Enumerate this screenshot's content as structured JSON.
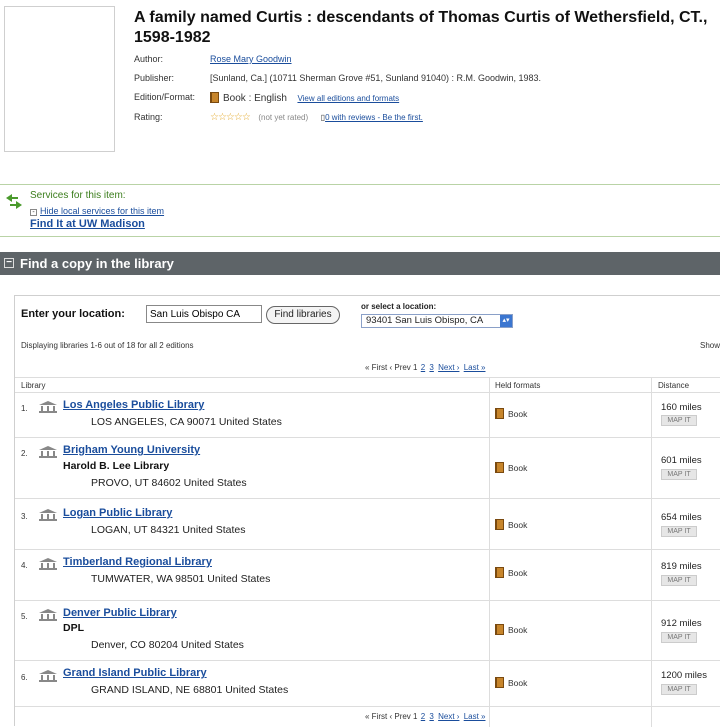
{
  "book": {
    "title": "A family named Curtis : descendants of Thomas Curtis of Wethersfield, CT., 1598-1982",
    "author_label": "Author:",
    "author": "Rose Mary Goodwin",
    "publisher_label": "Publisher:",
    "publisher": "[Sunland, Ca.] (10711 Sherman Grove #51, Sunland 91040) : R.M. Goodwin, 1983.",
    "edition_label": "Edition/Format:",
    "edition": "Book : English",
    "edition_link": "View all editions and formats",
    "rating_label": "Rating:",
    "stars": "☆☆☆☆☆",
    "rating_text": "(not yet rated)",
    "reviews_link": "0 with reviews - Be the first."
  },
  "services": {
    "heading": "Services for this item:",
    "hide_link": "Hide local services for this item",
    "find_link": "Find It at UW Madison"
  },
  "find_copy": {
    "heading": "Find a copy in the library",
    "location_label": "Enter your location:",
    "location_value": "San Luis Obispo CA",
    "find_button": "Find libraries",
    "or_label": "or select a location:",
    "select_value": "93401 San Luis Obispo, CA",
    "displaying": "Displaying libraries 1-6 out of 18 for all 2 editions",
    "show": "Show",
    "pager": {
      "first": "« First",
      "prev": "‹ Prev",
      "p1": "1",
      "p2": "2",
      "p3": "3",
      "next": "Next ›",
      "last": "Last »"
    },
    "columns": {
      "library": "Library",
      "formats": "Held formats",
      "distance": "Distance"
    },
    "map_label": "MAP IT"
  },
  "libraries": [
    {
      "num": "1.",
      "name": "Los Angeles Public Library",
      "sub": "",
      "addr": "LOS ANGELES, CA 90071 United States",
      "format": "Book",
      "distance": "160 miles"
    },
    {
      "num": "2.",
      "name": "Brigham Young University",
      "sub": "Harold B. Lee Library",
      "addr": "PROVO, UT 84602 United States",
      "format": "Book",
      "distance": "601 miles"
    },
    {
      "num": "3.",
      "name": "Logan Public Library",
      "sub": "",
      "addr": "LOGAN, UT 84321 United States",
      "format": "Book",
      "distance": "654 miles"
    },
    {
      "num": "4.",
      "name": "Timberland Regional Library",
      "sub": "",
      "addr": "TUMWATER, WA 98501 United States",
      "format": "Book",
      "distance": "819 miles"
    },
    {
      "num": "5.",
      "name": "Denver Public Library",
      "sub": "DPL",
      "addr": "Denver, CO 80204 United States",
      "format": "Book",
      "distance": "912 miles"
    },
    {
      "num": "6.",
      "name": "Grand Island Public Library",
      "sub": "",
      "addr": "GRAND ISLAND, NE 68801 United States",
      "format": "Book",
      "distance": "1200 miles"
    }
  ]
}
